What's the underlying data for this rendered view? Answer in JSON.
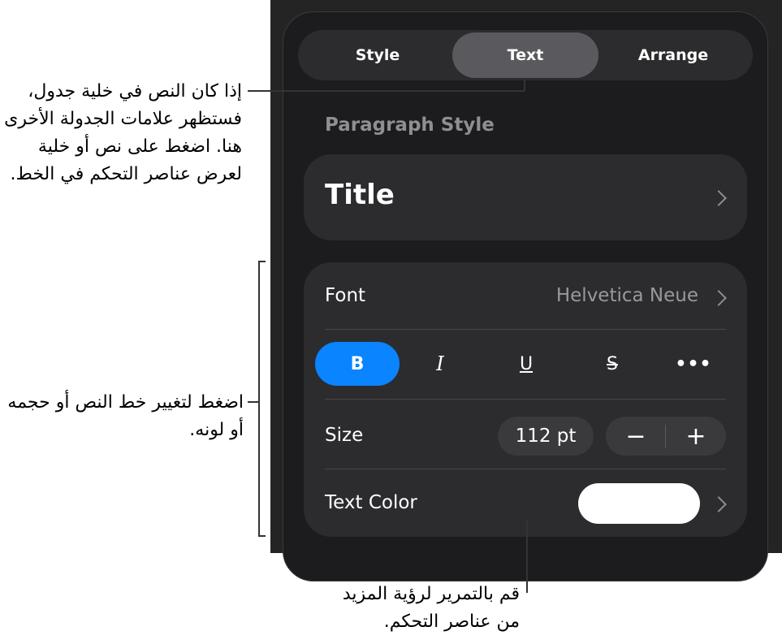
{
  "tabs": [
    "Style",
    "Text",
    "Arrange"
  ],
  "paragraph_style": {
    "label": "Paragraph Style",
    "value": "Title"
  },
  "font": {
    "label": "Font",
    "value": "Helvetica Neue"
  },
  "format_buttons": {
    "bold": "B",
    "italic": "I",
    "underline": "U",
    "strikethrough": "S",
    "more": "•••"
  },
  "size": {
    "label": "Size",
    "value": "112 pt",
    "minus": "−",
    "plus": "+"
  },
  "text_color": {
    "label": "Text Color",
    "swatch": "#ffffff"
  },
  "callouts": {
    "table_tabs": "إذا كان النص في خلية جدول، فستظهر علامات الجدولة الأخرى هنا. اضغط على نص أو خلية لعرض عناصر التحكم في الخط.",
    "font_controls": "اضغط لتغيير خط النص أو حجمه أو لونه.",
    "scroll_more": "قم بالتمرير لرؤية المزيد من عناصر التحكم."
  },
  "colors": {
    "accent": "#0a84ff",
    "panel": "#1c1c1e",
    "card": "#2c2c2e"
  }
}
